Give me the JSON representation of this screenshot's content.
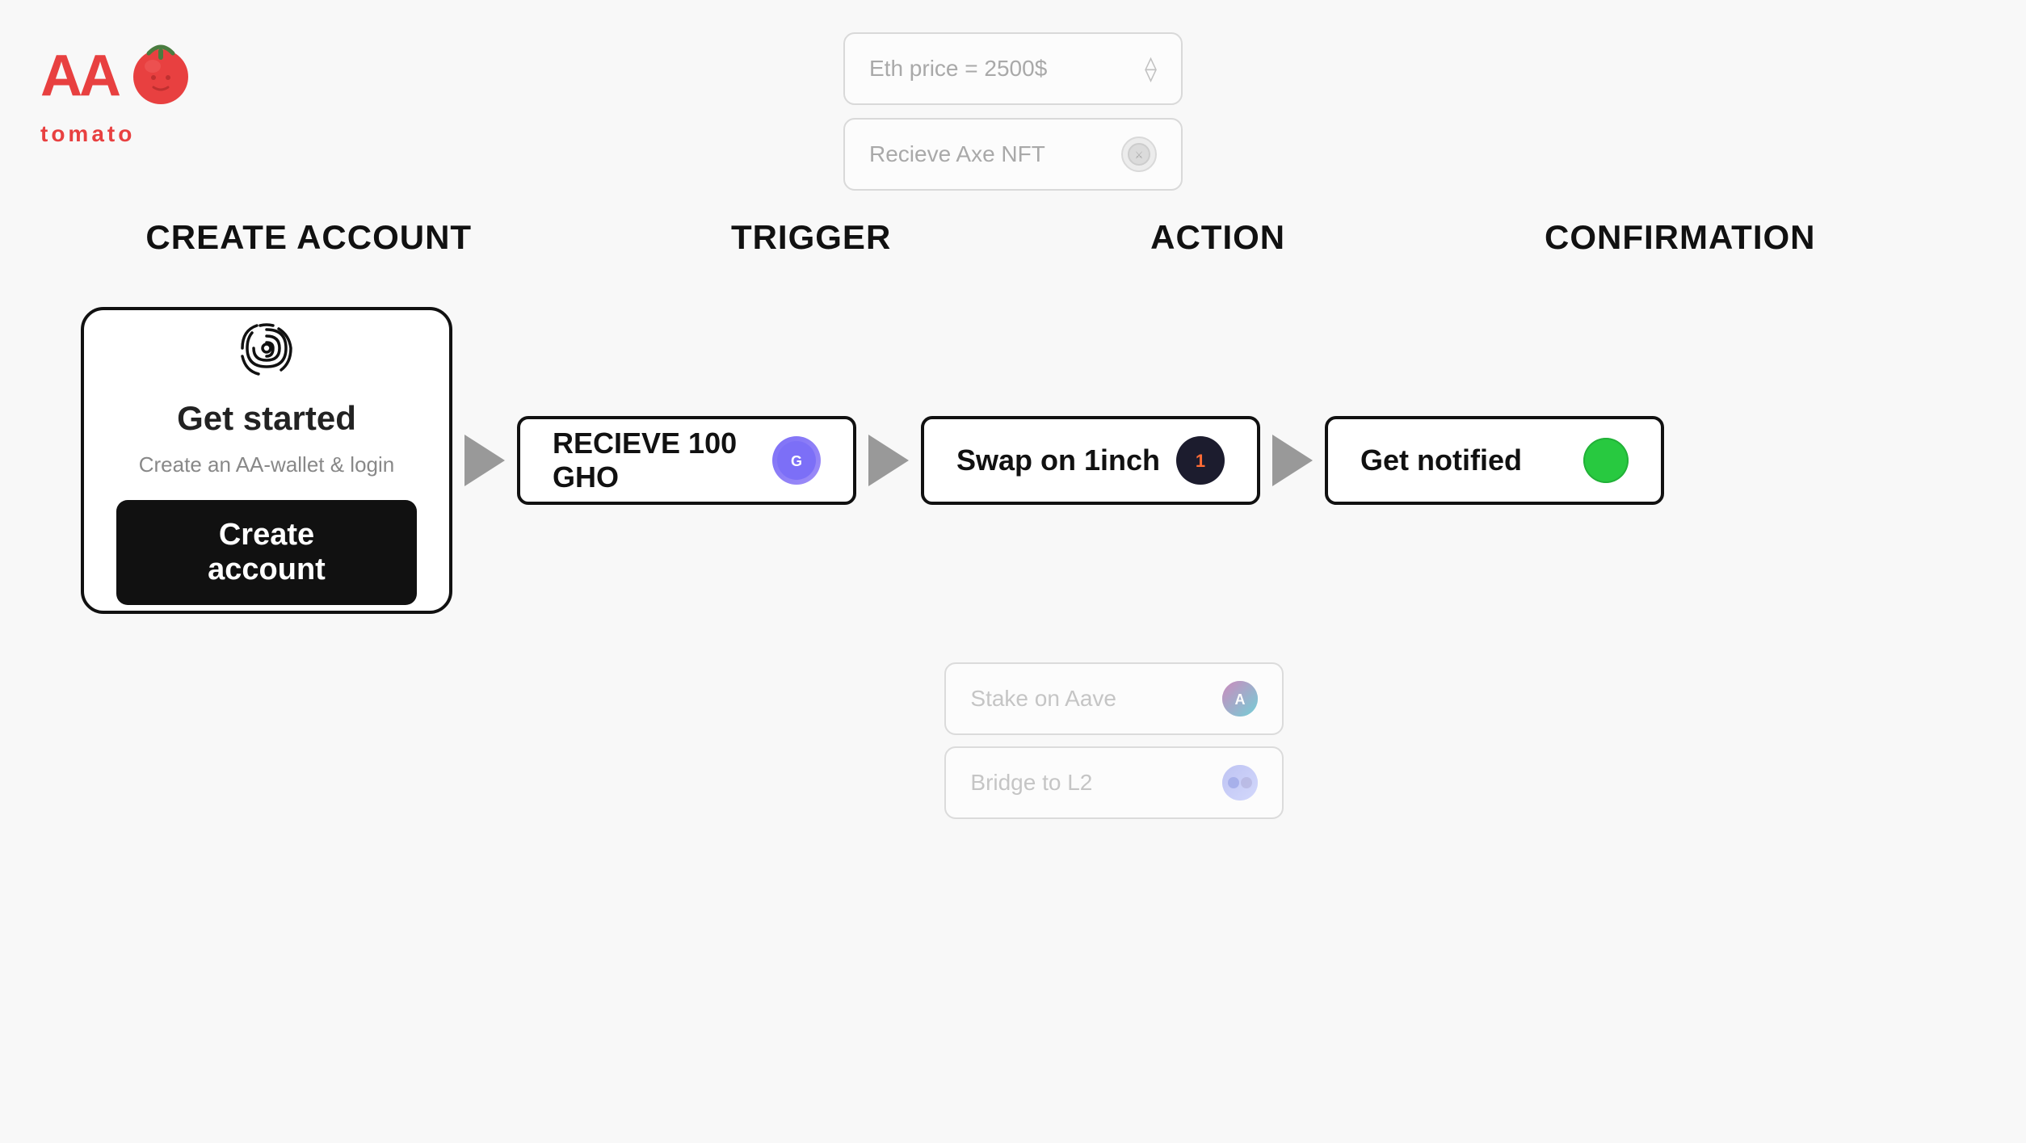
{
  "logo": {
    "aa_text": "AA",
    "label": "tomato"
  },
  "top_cards": [
    {
      "label": "Eth price = 2500$",
      "icon": "eth"
    },
    {
      "label": "Recieve Axe NFT",
      "icon": "axe"
    }
  ],
  "columns": {
    "create_account": "CREATE ACCOUNT",
    "trigger": "TRIGGER",
    "action": "ACTION",
    "confirmation": "CONFIRMATION"
  },
  "create_account_card": {
    "icon": "fingerprint",
    "title": "Get started",
    "subtitle": "Create an AA-wallet & login",
    "button_label": "Create account"
  },
  "trigger_card": {
    "label": "RECIEVE 100 GHO",
    "icon": "gho"
  },
  "action_card": {
    "label": "Swap on 1inch",
    "icon": "oneinch"
  },
  "confirm_card": {
    "label": "Get notified",
    "icon": "notify"
  },
  "bottom_cards": [
    {
      "label": "Stake on Aave",
      "icon": "aave"
    },
    {
      "label": "Bridge to L2",
      "icon": "bridge"
    }
  ]
}
